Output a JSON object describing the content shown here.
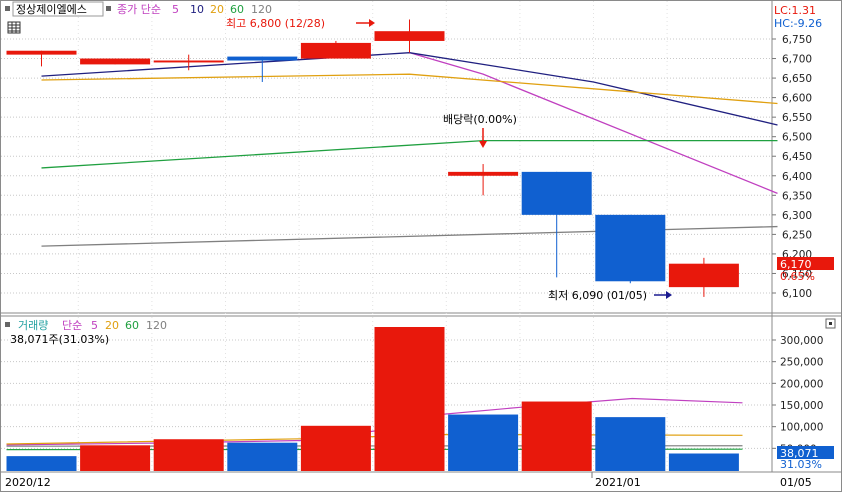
{
  "header": {
    "stock_name": "정상제이엘에스",
    "indicator": "종가 단순",
    "ma_periods": [
      "5",
      "10",
      "20",
      "60",
      "120"
    ],
    "lc_label": "LC:1.31",
    "hc_label": "HC:-9.26"
  },
  "volume_header": {
    "title": "거래량",
    "indicator": "단순",
    "ma_periods": [
      "5",
      "20",
      "60",
      "120"
    ],
    "current_text": "38,071주(31.03%)"
  },
  "colors": {
    "up": "#e8180c",
    "down": "#1060d0",
    "ma5": "#c040c0",
    "ma10": "#202080",
    "ma20": "#e0a010",
    "ma60": "#20a040",
    "ma120": "#808080"
  },
  "chart_data": [
    {
      "type": "candlestick",
      "title": "",
      "ylim": [
        6070,
        6810
      ],
      "yticks": [
        "6,750",
        "6,700",
        "6,650",
        "6,600",
        "6,550",
        "6,500",
        "6,450",
        "6,400",
        "6,350",
        "6,300",
        "6,250",
        "6,200",
        "6,150",
        "6,100"
      ],
      "candles": [
        {
          "open": 6710,
          "high": 6720,
          "low": 6680,
          "close": 6720
        },
        {
          "open": 6685,
          "high": 6700,
          "low": 6685,
          "close": 6700
        },
        {
          "open": 6690,
          "high": 6710,
          "low": 6670,
          "close": 6695
        },
        {
          "open": 6705,
          "high": 6705,
          "low": 6640,
          "close": 6695
        },
        {
          "open": 6700,
          "high": 6745,
          "low": 6700,
          "close": 6740
        },
        {
          "open": 6745,
          "high": 6800,
          "low": 6715,
          "close": 6770
        },
        {
          "open": 6400,
          "high": 6430,
          "low": 6350,
          "close": 6410
        },
        {
          "open": 6410,
          "high": 6410,
          "low": 6140,
          "close": 6300
        },
        {
          "open": 6300,
          "high": 6300,
          "low": 6125,
          "close": 6130
        },
        {
          "open": 6115,
          "high": 6190,
          "low": 6090,
          "close": 6175
        }
      ],
      "ma_lines": [
        {
          "name": "5",
          "points": [
            [
              5,
              6715
            ],
            [
              6,
              6660
            ],
            [
              10,
              6355
            ]
          ]
        },
        {
          "name": "10",
          "points": [
            [
              0,
              6655
            ],
            [
              5,
              6715
            ],
            [
              7.5,
              6640
            ],
            [
              10,
              6530
            ]
          ]
        },
        {
          "name": "20",
          "points": [
            [
              0,
              6645
            ],
            [
              5,
              6660
            ],
            [
              10,
              6585
            ]
          ]
        },
        {
          "name": "60",
          "points": [
            [
              0,
              6420
            ],
            [
              6,
              6490
            ],
            [
              10,
              6490
            ]
          ]
        },
        {
          "name": "120",
          "points": [
            [
              0,
              6220
            ],
            [
              10,
              6270
            ]
          ]
        }
      ],
      "annotations": {
        "high": "최고 6,800 (12/28)",
        "dividend": "배당락(0.00%)",
        "low": "최저 6,090 (01/05)"
      },
      "current_price": "6,170",
      "current_change": "0.65%"
    },
    {
      "type": "bar",
      "title": "",
      "ylim": [
        0,
        350000
      ],
      "yticks": [
        "300,000",
        "250,000",
        "200,000",
        "150,000",
        "100,000",
        "50,000"
      ],
      "values": [
        32000,
        57000,
        71000,
        63000,
        102000,
        330000,
        128000,
        158000,
        122000,
        38071
      ],
      "directions": [
        "down",
        "up",
        "up",
        "down",
        "up",
        "up",
        "down",
        "up",
        "down",
        "down"
      ],
      "ma_lines": [
        {
          "name": "5",
          "points": [
            [
              0,
              58000
            ],
            [
              2,
              62000
            ],
            [
              4,
              68000
            ],
            [
              5,
              90000
            ],
            [
              5.5,
              122000
            ],
            [
              7,
              145000
            ],
            [
              8.5,
              165000
            ],
            [
              10,
              155000
            ]
          ]
        },
        {
          "name": "20",
          "points": [
            [
              0,
              60000
            ],
            [
              4,
              72000
            ],
            [
              6,
              82000
            ],
            [
              10,
              80000
            ]
          ]
        },
        {
          "name": "60",
          "points": [
            [
              0,
              47000
            ],
            [
              10,
              48000
            ]
          ]
        },
        {
          "name": "120",
          "points": [
            [
              0,
              55000
            ],
            [
              10,
              56000
            ]
          ]
        }
      ],
      "current_value": "38,071",
      "current_pct": "31.03%",
      "x_labels": [
        "2020/12",
        "2021/01",
        "01/05"
      ]
    }
  ]
}
